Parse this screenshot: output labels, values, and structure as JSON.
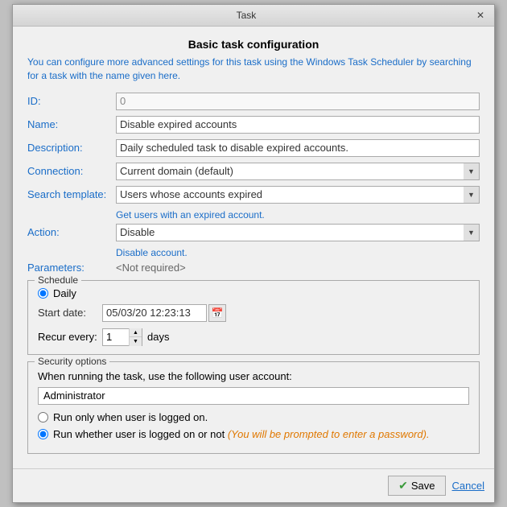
{
  "titleBar": {
    "label": "Task",
    "closeLabel": "✕"
  },
  "dialog": {
    "title": "Basic task configuration",
    "infoText": "You can configure more advanced settings for this task using the Windows Task Scheduler by searching for a task with the name given here.",
    "fields": {
      "idLabel": "ID:",
      "idValue": "0",
      "nameLabel": "Name:",
      "nameValue": "Disable expired accounts",
      "descriptionLabel": "Description:",
      "descriptionValue": "Daily scheduled task to disable expired accounts.",
      "connectionLabel": "Connection:",
      "connectionValue": "Current domain (default)",
      "searchTemplateLabel": "Search template:",
      "searchTemplateValue": "Users whose accounts expired",
      "searchTemplateHint": "Get users with an expired account.",
      "actionLabel": "Action:",
      "actionValue": "Disable",
      "actionHint": "Disable account.",
      "parametersLabel": "Parameters:",
      "parametersValue": "<Not required>"
    },
    "schedule": {
      "legend": "Schedule",
      "dailyLabel": "Daily",
      "startDateLabel": "Start date:",
      "startDateValue": "05/03/20 12:23:13",
      "recurLabel": "Recur every:",
      "recurValue": "1",
      "recurSuffix": "days"
    },
    "security": {
      "legend": "Security options",
      "whenRunningLabel": "When running the task, use the following user account:",
      "userValue": "Administrator",
      "radio1Label": "Run only when user is logged on.",
      "radio2Label": "Run whether user is logged on or not",
      "radio2Italic": "(You will be prompted to enter a password)."
    },
    "footer": {
      "saveIcon": "✔",
      "saveLabel": "Save",
      "cancelLabel": "Cancel"
    }
  }
}
